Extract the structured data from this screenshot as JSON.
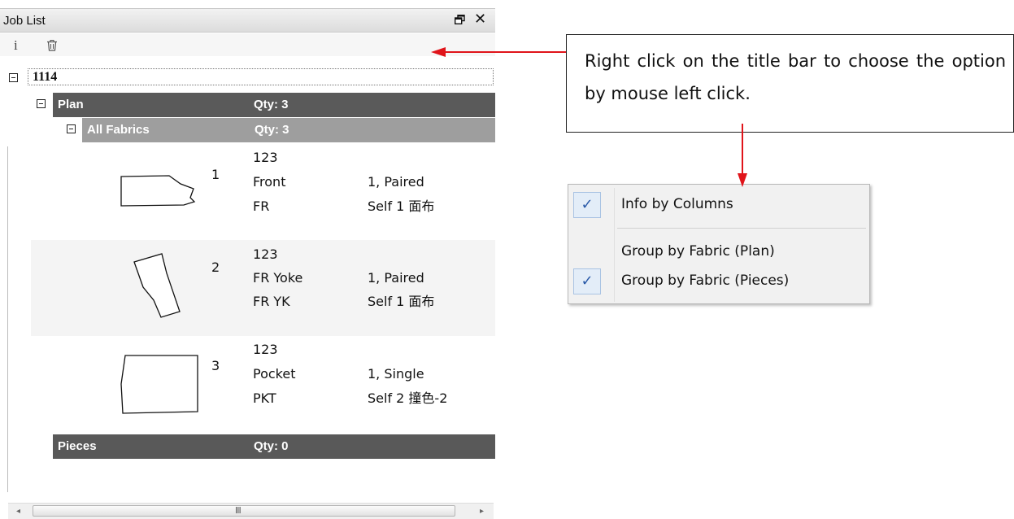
{
  "panel": {
    "title": "Job List",
    "float_glyph": "restore-window-icon",
    "close_glyph": "✕",
    "toolbar": {
      "info_glyph": "i",
      "trash_glyph": "trash-icon"
    }
  },
  "tree": {
    "root": "1114",
    "plan": {
      "label": "Plan",
      "qty": "Qty: 3"
    },
    "fabric": {
      "label": "All Fabrics",
      "qty": "Qty: 3"
    },
    "pieces_group": {
      "label": "Pieces",
      "qty": "Qty: 0"
    },
    "pieces": [
      {
        "number": "1",
        "code": "123",
        "name": "Front",
        "short": "FR",
        "pairing": "1, Paired",
        "fabric": "Self 1 面布"
      },
      {
        "number": "2",
        "code": "123",
        "name": "FR Yoke",
        "short": "FR YK",
        "pairing": "1, Paired",
        "fabric": "Self 1 面布"
      },
      {
        "number": "3",
        "code": "123",
        "name": "Pocket",
        "short": "PKT",
        "pairing": "1, Single",
        "fabric": "Self 2 撞色-2"
      }
    ]
  },
  "scrollbar": {
    "left": "◂",
    "right": "▸",
    "grip": "III"
  },
  "callout": {
    "text": "Right click on the title bar to choose the option by mouse left click."
  },
  "context_menu": {
    "items": [
      {
        "label": "Info by Columns",
        "checked": true
      },
      {
        "label": "Group by Fabric (Plan)",
        "checked": false
      },
      {
        "label": "Group by Fabric (Pieces)",
        "checked": true
      }
    ],
    "check_glyph": "✓"
  },
  "colors": {
    "arrow": "#e0141a",
    "plan_band": "#5a5a5a",
    "fabric_band": "#9e9e9e",
    "check": "#2a5aa8"
  }
}
